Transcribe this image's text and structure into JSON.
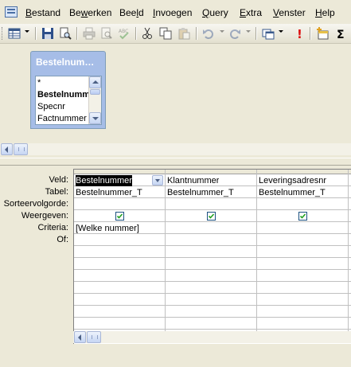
{
  "menu": {
    "items": [
      {
        "label": "Bestand",
        "underline": "B",
        "rest": "estand"
      },
      {
        "label": "Bewerken",
        "pre": "Be",
        "underline": "w",
        "rest": "erken"
      },
      {
        "label": "Beeld",
        "pre": "Bee",
        "underline": "l",
        "rest": "d"
      },
      {
        "label": "Invoegen",
        "underline": "I",
        "rest": "nvoegen"
      },
      {
        "label": "Query",
        "underline": "Q",
        "rest": "uery"
      },
      {
        "label": "Extra",
        "underline": "E",
        "rest": "xtra"
      },
      {
        "label": "Venster",
        "underline": "V",
        "rest": "enster"
      },
      {
        "label": "Help",
        "underline": "H",
        "rest": "elp"
      }
    ]
  },
  "toolbar": {
    "icons": [
      "view-icon",
      "save-icon",
      "search-file-icon",
      "print-icon",
      "print-preview-icon",
      "spelling-icon",
      "cut-icon",
      "copy-icon",
      "paste-icon",
      "undo-icon",
      "redo-icon",
      "query-type-icon",
      "run-icon",
      "show-table-icon",
      "sum-icon"
    ],
    "sum_glyph": "Σ",
    "run_glyph": "!"
  },
  "table_window": {
    "title": "Bestelnum…",
    "fields": [
      "*",
      "Bestelnummer",
      "Specnr",
      "Factnummer"
    ],
    "bold_field": "Bestelnummer"
  },
  "grid": {
    "row_labels": [
      "Veld:",
      "Tabel:",
      "Sorteervolgorde:",
      "Weergeven:",
      "Criteria:",
      "Of:"
    ],
    "columns": [
      {
        "veld": "Bestelnummer",
        "tabel": "Bestelnummer_T",
        "weergeven": true,
        "criteria": "[Welke nummer]"
      },
      {
        "veld": "Klantnummer",
        "tabel": "Bestelnummer_T",
        "weergeven": true,
        "criteria": ""
      },
      {
        "veld": "Leveringsadresnr",
        "tabel": "Bestelnummer_T",
        "weergeven": true,
        "criteria": ""
      }
    ]
  }
}
